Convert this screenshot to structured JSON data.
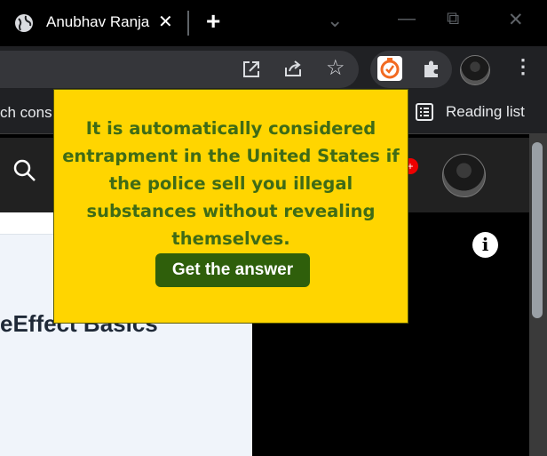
{
  "tab": {
    "title": "Anubhav Ranja",
    "close_glyph": "✕",
    "new_tab_glyph": "+"
  },
  "window_controls": {
    "minimize": "—",
    "restore": "⧉",
    "close": "✕",
    "tab_search": "⌄"
  },
  "bookmarks": {
    "partial_text": "ch cons",
    "reading_list_label": "Reading list"
  },
  "page": {
    "heading": "eEffect Basics",
    "notification_badge": "+",
    "info_glyph": "i"
  },
  "popup": {
    "question": "It is automatically considered entrapment in the United States if the police sell you illegal substances without revealing themselves.",
    "button_label": "Get the answer"
  },
  "colors": {
    "popup_bg": "#ffd500",
    "popup_text": "#3f6b16",
    "button_bg": "#2f5f0b"
  }
}
